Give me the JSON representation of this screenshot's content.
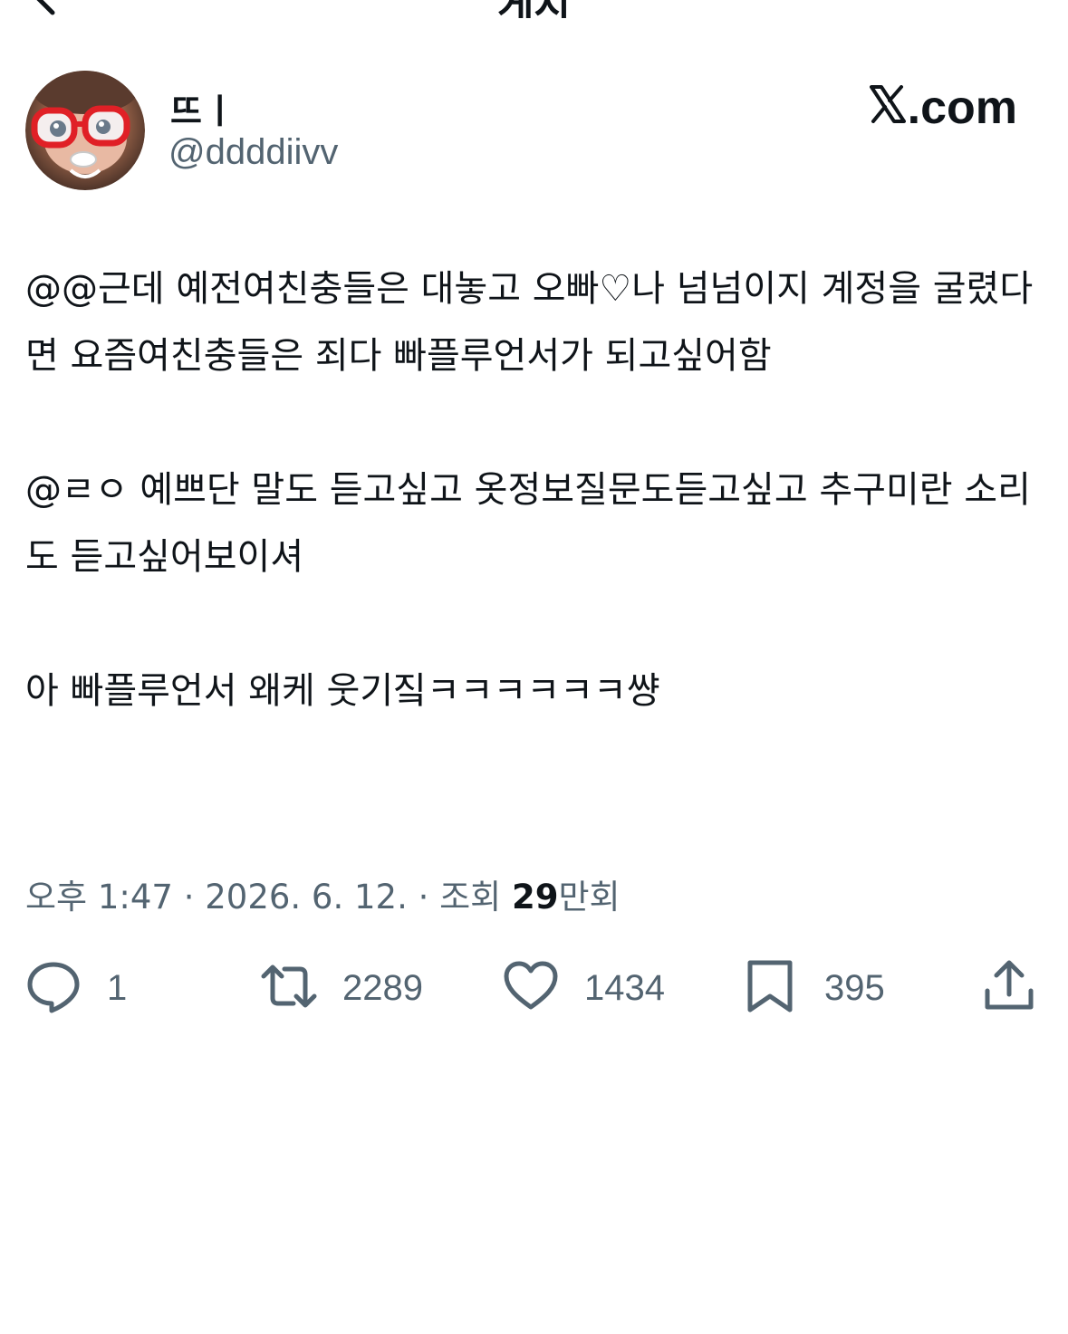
{
  "header": {
    "title": "게시",
    "back_icon": "chevron-left-icon"
  },
  "author": {
    "display_name": "뜨ㅣ",
    "handle": "@ddddiivv",
    "avatar_icon": "avatar-doll-with-red-glasses"
  },
  "brand": {
    "logo_text": ".com",
    "logo_icon": "x-logo-icon"
  },
  "tweet": {
    "paragraphs": [
      "@@근데 예전여친충들은 대놓고 오빠♡나 넘넘이지 계정을 굴렸다면 요즘여친충들은 죄다 빠플루언서가 되고싶어함",
      "@ㄹㅇ 예쁘단 말도 듣고싶고 옷정보질문도듣고싶고 추구미란 소리도 듣고싶어보이셔",
      "아 빠플루언서 왜케 웃기짘ㅋㅋㅋㅋㅋㅋ썅"
    ]
  },
  "meta": {
    "time": "오후 1:47",
    "separator": "·",
    "date": "2026. 6. 12.",
    "views_label": "조회",
    "views_number": "29",
    "views_unit": "만회"
  },
  "actions": {
    "reply": {
      "icon": "reply-bubble-icon",
      "count": "1"
    },
    "repost": {
      "icon": "repost-icon",
      "count": "2289"
    },
    "like": {
      "icon": "heart-icon",
      "count": "1434"
    },
    "bookmark": {
      "icon": "bookmark-icon",
      "count": "395"
    },
    "share": {
      "icon": "share-icon"
    }
  },
  "colors": {
    "text": "#0f1419",
    "secondary": "#536471",
    "background": "#ffffff"
  }
}
